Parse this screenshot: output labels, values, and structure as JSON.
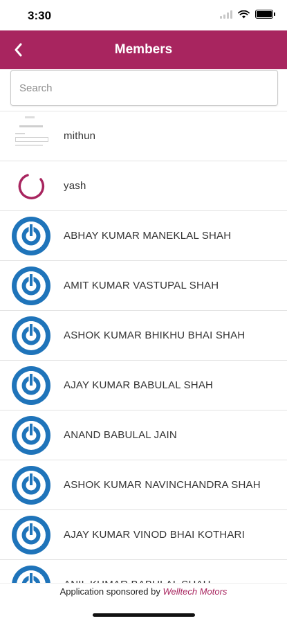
{
  "status": {
    "time": "3:30"
  },
  "header": {
    "title": "Members"
  },
  "search": {
    "placeholder": "Search"
  },
  "members": [
    {
      "name": "mithun",
      "avatar": "screenshot-thumbnail"
    },
    {
      "name": "yash",
      "avatar": "loading-spinner"
    },
    {
      "name": "ABHAY KUMAR MANEKLAL SHAH",
      "avatar": "power-logo-icon"
    },
    {
      "name": "AMIT KUMAR VASTUPAL SHAH",
      "avatar": "power-logo-icon"
    },
    {
      "name": "ASHOK KUMAR BHIKHU BHAI SHAH",
      "avatar": "power-logo-icon"
    },
    {
      "name": "AJAY KUMAR BABULAL SHAH",
      "avatar": "power-logo-icon"
    },
    {
      "name": "ANAND BABULAL JAIN",
      "avatar": "power-logo-icon"
    },
    {
      "name": "ASHOK KUMAR NAVINCHANDRA SHAH",
      "avatar": "power-logo-icon"
    },
    {
      "name": "AJAY KUMAR VINOD BHAI KOTHARI",
      "avatar": "power-logo-icon"
    },
    {
      "name": "ANIL KUMAR BABULAL SHAH",
      "avatar": "power-logo-icon"
    }
  ],
  "footer": {
    "prefix": "Application sponsored by",
    "brand": "Welltech Motors"
  },
  "colors": {
    "primary": "#a8255f",
    "logo_blue": "#1f74ba"
  }
}
